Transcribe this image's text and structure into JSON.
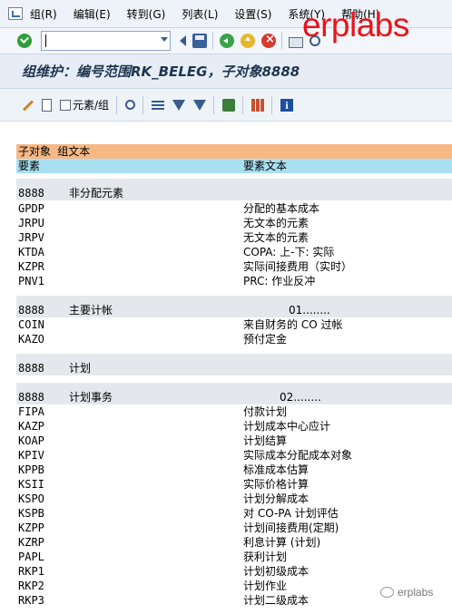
{
  "menu": {
    "items": [
      "组(R)",
      "编辑(E)",
      "转到(G)",
      "列表(L)",
      "设置(S)",
      "系统(Y)",
      "帮助(H)"
    ]
  },
  "toolbar": {
    "command_value": "",
    "logo_text": "erplabs",
    "icons": [
      "check-icon",
      "back-icon",
      "save-icon",
      "green-back-icon",
      "yellow-up-icon",
      "red-cancel-icon",
      "print-icon",
      "find-icon"
    ]
  },
  "title": "组维护：编号范围RK_BELEG，子对象8888",
  "app_toolbar": {
    "elements_label": "元素/组",
    "icons": [
      "pencil-icon",
      "document-icon",
      "zoom-icon",
      "sort-icon",
      "filter-icon",
      "funnel-icon",
      "export-icon",
      "grid-icon",
      "info-icon"
    ]
  },
  "list": {
    "header1": "子对象 组文本",
    "header2_col1": "要素",
    "header2_col2": "要素文本",
    "groups": [
      {
        "code": "8888",
        "name": "非分配元素",
        "range": "",
        "items": [
          {
            "key": "GPDP",
            "text": "分配的基本成本"
          },
          {
            "key": "JRPU",
            "text": "无文本的元素"
          },
          {
            "key": "JRPV",
            "text": "无文本的元素"
          },
          {
            "key": "KTDA",
            "text": "COPA: 上-下: 实际"
          },
          {
            "key": "KZPR",
            "text": "实际间接费用（实时）"
          },
          {
            "key": "PNV1",
            "text": "PRC: 作业反冲"
          }
        ]
      },
      {
        "code": "8888",
        "name": "主要计帐",
        "range": "01........",
        "items": [
          {
            "key": "COIN",
            "text": "来自财务的 CO 过帐"
          },
          {
            "key": "KAZO",
            "text": "预付定金"
          }
        ]
      },
      {
        "code": "8888",
        "name": "计划",
        "range": "",
        "items": []
      },
      {
        "code": "8888",
        "name": "计划事务",
        "range": "02........",
        "items": [
          {
            "key": "FIPA",
            "text": "付款计划"
          },
          {
            "key": "KAZP",
            "text": "计划成本中心应计"
          },
          {
            "key": "KOAP",
            "text": "计划结算"
          },
          {
            "key": "KPIV",
            "text": "实际成本分配成本对象"
          },
          {
            "key": "KPPB",
            "text": "标准成本估算"
          },
          {
            "key": "KSII",
            "text": "实际价格计算"
          },
          {
            "key": "KSPO",
            "text": "计划分解成本"
          },
          {
            "key": "KSPB",
            "text": "对 CO-PA 计划评估"
          },
          {
            "key": "KZPP",
            "text": "计划间接费用(定期)"
          },
          {
            "key": "KZRP",
            "text": "利息计算 (计划)"
          },
          {
            "key": "PAPL",
            "text": "获利计划"
          },
          {
            "key": "RKP1",
            "text": "计划初级成本"
          },
          {
            "key": "RKP2",
            "text": "计划作业"
          },
          {
            "key": "RKP3",
            "text": "计划二级成本"
          }
        ]
      }
    ]
  },
  "watermark": "erplabs"
}
